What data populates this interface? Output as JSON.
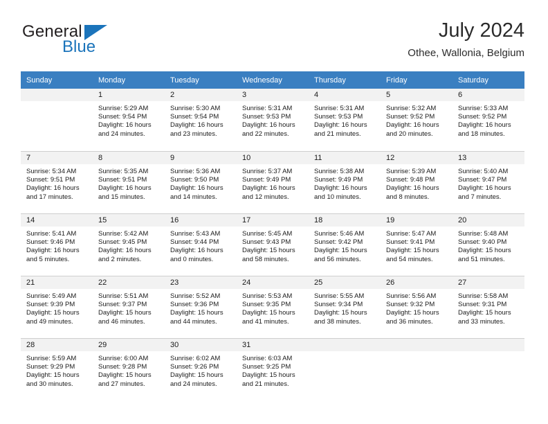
{
  "brand": {
    "name_dark": "General",
    "name_blue": "Blue",
    "triangle_icon": "brand-triangle-icon",
    "accent_color": "#1b74bb"
  },
  "header": {
    "title": "July 2024",
    "subtitle": "Othee, Wallonia, Belgium"
  },
  "calendar": {
    "header_bg": "#3a7fc1",
    "daynum_bg": "#f2f2f2",
    "weekdays": [
      "Sunday",
      "Monday",
      "Tuesday",
      "Wednesday",
      "Thursday",
      "Friday",
      "Saturday"
    ],
    "weeks": [
      [
        {
          "day": "",
          "sunrise": "",
          "sunset": "",
          "daylight_line1": "",
          "daylight_line2": ""
        },
        {
          "day": "1",
          "sunrise": "Sunrise: 5:29 AM",
          "sunset": "Sunset: 9:54 PM",
          "daylight_line1": "Daylight: 16 hours",
          "daylight_line2": "and 24 minutes."
        },
        {
          "day": "2",
          "sunrise": "Sunrise: 5:30 AM",
          "sunset": "Sunset: 9:54 PM",
          "daylight_line1": "Daylight: 16 hours",
          "daylight_line2": "and 23 minutes."
        },
        {
          "day": "3",
          "sunrise": "Sunrise: 5:31 AM",
          "sunset": "Sunset: 9:53 PM",
          "daylight_line1": "Daylight: 16 hours",
          "daylight_line2": "and 22 minutes."
        },
        {
          "day": "4",
          "sunrise": "Sunrise: 5:31 AM",
          "sunset": "Sunset: 9:53 PM",
          "daylight_line1": "Daylight: 16 hours",
          "daylight_line2": "and 21 minutes."
        },
        {
          "day": "5",
          "sunrise": "Sunrise: 5:32 AM",
          "sunset": "Sunset: 9:52 PM",
          "daylight_line1": "Daylight: 16 hours",
          "daylight_line2": "and 20 minutes."
        },
        {
          "day": "6",
          "sunrise": "Sunrise: 5:33 AM",
          "sunset": "Sunset: 9:52 PM",
          "daylight_line1": "Daylight: 16 hours",
          "daylight_line2": "and 18 minutes."
        }
      ],
      [
        {
          "day": "7",
          "sunrise": "Sunrise: 5:34 AM",
          "sunset": "Sunset: 9:51 PM",
          "daylight_line1": "Daylight: 16 hours",
          "daylight_line2": "and 17 minutes."
        },
        {
          "day": "8",
          "sunrise": "Sunrise: 5:35 AM",
          "sunset": "Sunset: 9:51 PM",
          "daylight_line1": "Daylight: 16 hours",
          "daylight_line2": "and 15 minutes."
        },
        {
          "day": "9",
          "sunrise": "Sunrise: 5:36 AM",
          "sunset": "Sunset: 9:50 PM",
          "daylight_line1": "Daylight: 16 hours",
          "daylight_line2": "and 14 minutes."
        },
        {
          "day": "10",
          "sunrise": "Sunrise: 5:37 AM",
          "sunset": "Sunset: 9:49 PM",
          "daylight_line1": "Daylight: 16 hours",
          "daylight_line2": "and 12 minutes."
        },
        {
          "day": "11",
          "sunrise": "Sunrise: 5:38 AM",
          "sunset": "Sunset: 9:49 PM",
          "daylight_line1": "Daylight: 16 hours",
          "daylight_line2": "and 10 minutes."
        },
        {
          "day": "12",
          "sunrise": "Sunrise: 5:39 AM",
          "sunset": "Sunset: 9:48 PM",
          "daylight_line1": "Daylight: 16 hours",
          "daylight_line2": "and 8 minutes."
        },
        {
          "day": "13",
          "sunrise": "Sunrise: 5:40 AM",
          "sunset": "Sunset: 9:47 PM",
          "daylight_line1": "Daylight: 16 hours",
          "daylight_line2": "and 7 minutes."
        }
      ],
      [
        {
          "day": "14",
          "sunrise": "Sunrise: 5:41 AM",
          "sunset": "Sunset: 9:46 PM",
          "daylight_line1": "Daylight: 16 hours",
          "daylight_line2": "and 5 minutes."
        },
        {
          "day": "15",
          "sunrise": "Sunrise: 5:42 AM",
          "sunset": "Sunset: 9:45 PM",
          "daylight_line1": "Daylight: 16 hours",
          "daylight_line2": "and 2 minutes."
        },
        {
          "day": "16",
          "sunrise": "Sunrise: 5:43 AM",
          "sunset": "Sunset: 9:44 PM",
          "daylight_line1": "Daylight: 16 hours",
          "daylight_line2": "and 0 minutes."
        },
        {
          "day": "17",
          "sunrise": "Sunrise: 5:45 AM",
          "sunset": "Sunset: 9:43 PM",
          "daylight_line1": "Daylight: 15 hours",
          "daylight_line2": "and 58 minutes."
        },
        {
          "day": "18",
          "sunrise": "Sunrise: 5:46 AM",
          "sunset": "Sunset: 9:42 PM",
          "daylight_line1": "Daylight: 15 hours",
          "daylight_line2": "and 56 minutes."
        },
        {
          "day": "19",
          "sunrise": "Sunrise: 5:47 AM",
          "sunset": "Sunset: 9:41 PM",
          "daylight_line1": "Daylight: 15 hours",
          "daylight_line2": "and 54 minutes."
        },
        {
          "day": "20",
          "sunrise": "Sunrise: 5:48 AM",
          "sunset": "Sunset: 9:40 PM",
          "daylight_line1": "Daylight: 15 hours",
          "daylight_line2": "and 51 minutes."
        }
      ],
      [
        {
          "day": "21",
          "sunrise": "Sunrise: 5:49 AM",
          "sunset": "Sunset: 9:39 PM",
          "daylight_line1": "Daylight: 15 hours",
          "daylight_line2": "and 49 minutes."
        },
        {
          "day": "22",
          "sunrise": "Sunrise: 5:51 AM",
          "sunset": "Sunset: 9:37 PM",
          "daylight_line1": "Daylight: 15 hours",
          "daylight_line2": "and 46 minutes."
        },
        {
          "day": "23",
          "sunrise": "Sunrise: 5:52 AM",
          "sunset": "Sunset: 9:36 PM",
          "daylight_line1": "Daylight: 15 hours",
          "daylight_line2": "and 44 minutes."
        },
        {
          "day": "24",
          "sunrise": "Sunrise: 5:53 AM",
          "sunset": "Sunset: 9:35 PM",
          "daylight_line1": "Daylight: 15 hours",
          "daylight_line2": "and 41 minutes."
        },
        {
          "day": "25",
          "sunrise": "Sunrise: 5:55 AM",
          "sunset": "Sunset: 9:34 PM",
          "daylight_line1": "Daylight: 15 hours",
          "daylight_line2": "and 38 minutes."
        },
        {
          "day": "26",
          "sunrise": "Sunrise: 5:56 AM",
          "sunset": "Sunset: 9:32 PM",
          "daylight_line1": "Daylight: 15 hours",
          "daylight_line2": "and 36 minutes."
        },
        {
          "day": "27",
          "sunrise": "Sunrise: 5:58 AM",
          "sunset": "Sunset: 9:31 PM",
          "daylight_line1": "Daylight: 15 hours",
          "daylight_line2": "and 33 minutes."
        }
      ],
      [
        {
          "day": "28",
          "sunrise": "Sunrise: 5:59 AM",
          "sunset": "Sunset: 9:29 PM",
          "daylight_line1": "Daylight: 15 hours",
          "daylight_line2": "and 30 minutes."
        },
        {
          "day": "29",
          "sunrise": "Sunrise: 6:00 AM",
          "sunset": "Sunset: 9:28 PM",
          "daylight_line1": "Daylight: 15 hours",
          "daylight_line2": "and 27 minutes."
        },
        {
          "day": "30",
          "sunrise": "Sunrise: 6:02 AM",
          "sunset": "Sunset: 9:26 PM",
          "daylight_line1": "Daylight: 15 hours",
          "daylight_line2": "and 24 minutes."
        },
        {
          "day": "31",
          "sunrise": "Sunrise: 6:03 AM",
          "sunset": "Sunset: 9:25 PM",
          "daylight_line1": "Daylight: 15 hours",
          "daylight_line2": "and 21 minutes."
        },
        {
          "day": "",
          "sunrise": "",
          "sunset": "",
          "daylight_line1": "",
          "daylight_line2": ""
        },
        {
          "day": "",
          "sunrise": "",
          "sunset": "",
          "daylight_line1": "",
          "daylight_line2": ""
        },
        {
          "day": "",
          "sunrise": "",
          "sunset": "",
          "daylight_line1": "",
          "daylight_line2": ""
        }
      ]
    ]
  }
}
